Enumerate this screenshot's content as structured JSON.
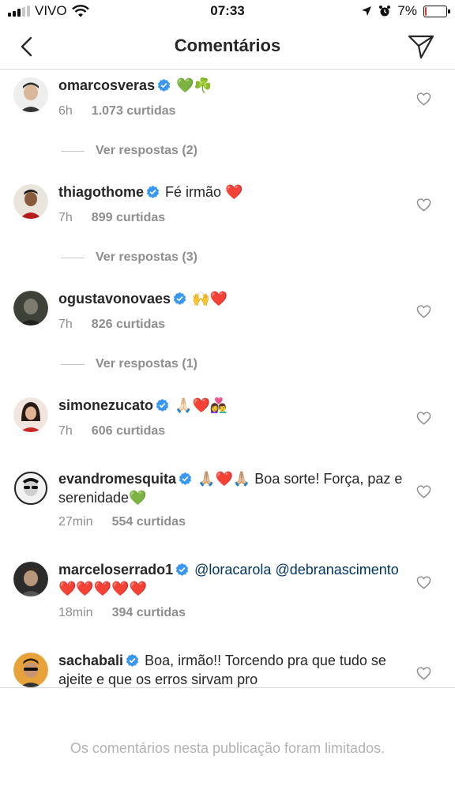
{
  "status_bar": {
    "carrier": "VIVO",
    "time": "07:33",
    "battery": "7%",
    "battery_level": 0.07,
    "icons": [
      "signal-icon",
      "wifi-icon",
      "location-arrow-icon",
      "alarm-icon",
      "battery-icon"
    ]
  },
  "nav": {
    "title": "Comentários",
    "back_icon": "chevron-left-icon",
    "send_icon": "paper-plane-icon"
  },
  "comments": [
    {
      "username": "omarcosveras",
      "text": "💚☘️",
      "time": "6h",
      "likes": "1.073 curtidas",
      "replies": "Ver respostas (2)"
    },
    {
      "username": "thiagothome",
      "text": "Fé irmão ❤️",
      "time": "7h",
      "likes": "899 curtidas",
      "replies": "Ver respostas (3)"
    },
    {
      "username": "ogustavonovaes",
      "text": "🙌❤️",
      "time": "7h",
      "likes": "826 curtidas",
      "replies": "Ver respostas (1)"
    },
    {
      "username": "simonezucato",
      "text": "🙏🏻❤️👩‍❤️‍👨",
      "time": "7h",
      "likes": "606 curtidas"
    },
    {
      "username": "evandromesquita",
      "text": "🙏🏼❤️🙏🏼 Boa sorte! Força, paz e serenidade💚",
      "time": "27min",
      "likes": "554 curtidas"
    },
    {
      "username": "marceloserrado1",
      "mention1": "@loracarola",
      "mention2": "@debranascimento",
      "text": "❤️❤️❤️❤️❤️",
      "time": "18min",
      "likes": "394 curtidas"
    },
    {
      "username": "sachabali",
      "text": "Boa, irmão!! Torcendo pra que tudo se ajeite e que os erros sirvam pro"
    }
  ],
  "footer": {
    "message": "Os comentários nesta publicação foram limitados."
  },
  "colors": {
    "verified_blue": "#3897f0",
    "mention_blue": "#003569",
    "muted_gray": "#8e8e8e",
    "battery_red": "#e53935"
  }
}
